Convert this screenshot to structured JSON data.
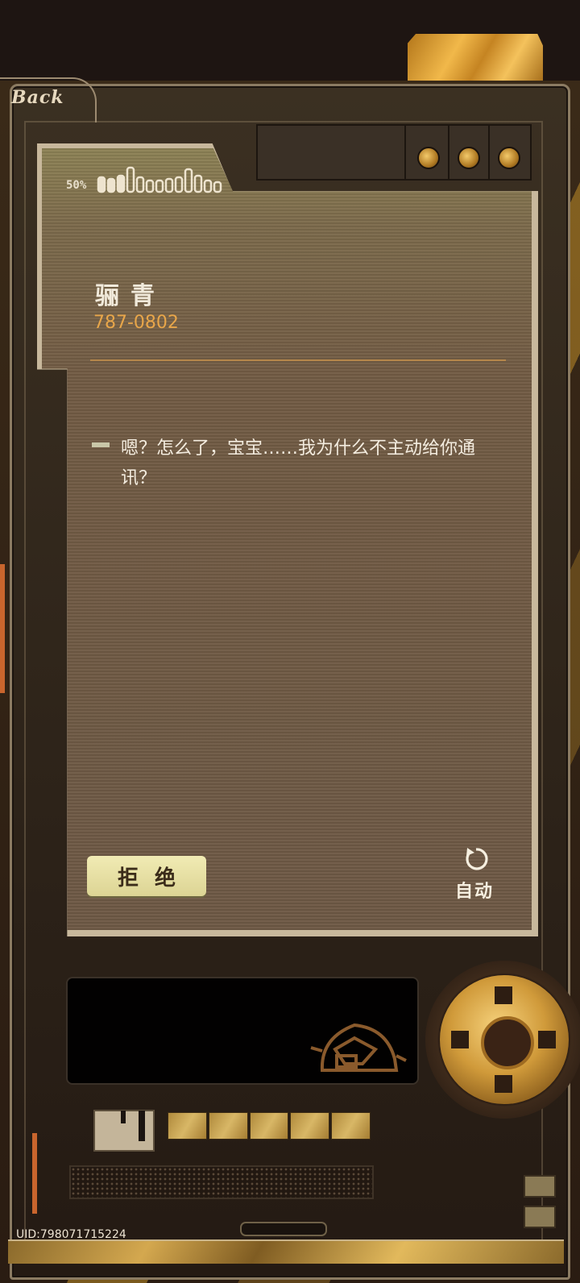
{
  "nav": {
    "back_label": "Back"
  },
  "signal": {
    "percent_label": "50%"
  },
  "contact": {
    "name": "骊青",
    "number": "787-0802"
  },
  "message": {
    "text": "嗯？怎么了，宝宝……我为什么不主动给你通讯？"
  },
  "actions": {
    "reject_label": "拒绝",
    "auto_label": "自动"
  },
  "footer": {
    "uid": "UID:798071715224"
  },
  "colors": {
    "accent_gold": "#e8a64a",
    "reject_bg": "#f1ebb4",
    "screen_bg": "#735c45"
  }
}
